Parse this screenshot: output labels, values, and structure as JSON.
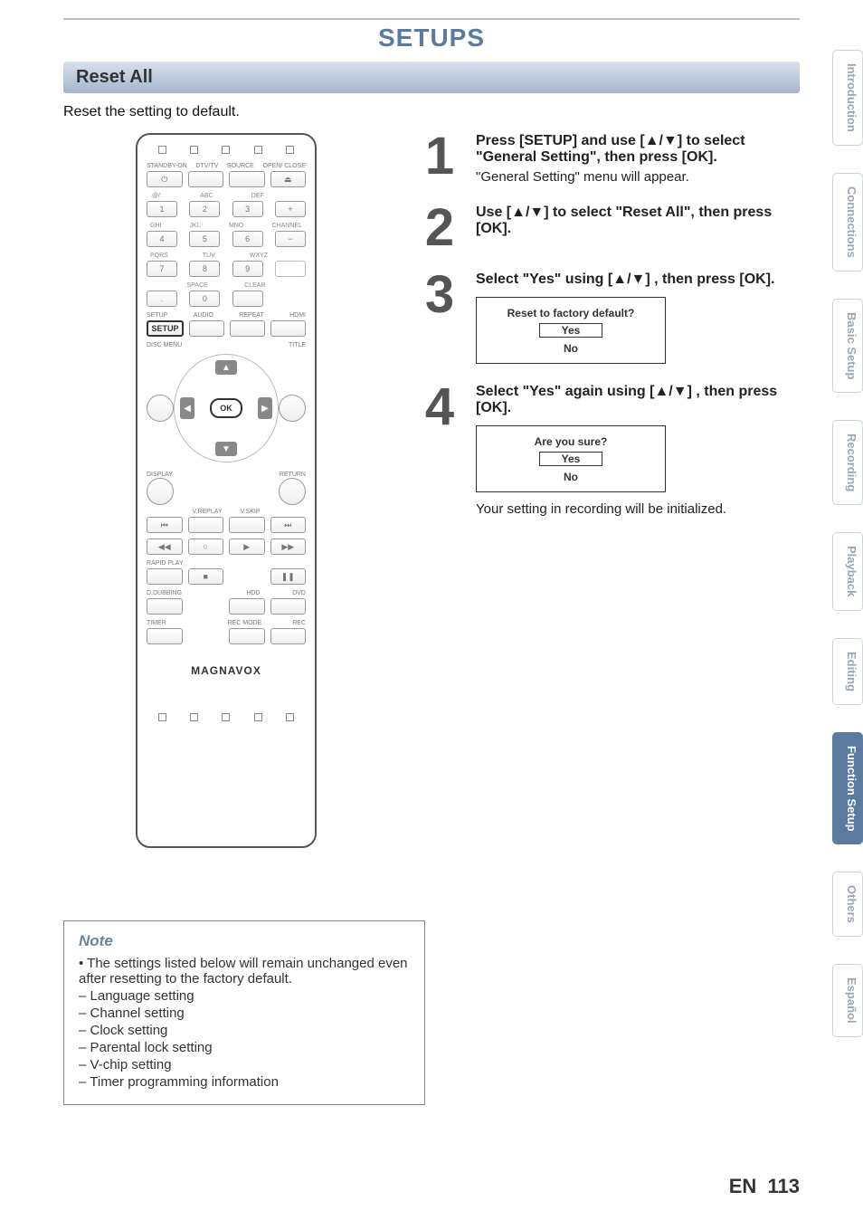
{
  "page": {
    "title": "SETUPS",
    "section": "Reset All",
    "intro": "Reset the setting to default.",
    "lang_code": "EN",
    "page_number": "113"
  },
  "remote": {
    "row1_labels": [
      "STANDBY-ON",
      "DTV/TV",
      "SOURCE",
      "OPEN/\nCLOSE"
    ],
    "row1_btns": [
      "⏻",
      "",
      "",
      "⏏"
    ],
    "keypad_labels_top": [
      ".@/:",
      "ABC",
      "DEF",
      ""
    ],
    "keypad_top_right": "+",
    "keypad_row1": [
      "1",
      "2",
      "3"
    ],
    "keypad_labels_mid": [
      "GHI",
      "JKL",
      "MNO",
      "CHANNEL"
    ],
    "keypad_row2": [
      "4",
      "5",
      "6"
    ],
    "keypad_mid_right": "−",
    "keypad_labels_bot": [
      "PQRS",
      "TUV",
      "WXYZ",
      ""
    ],
    "keypad_row3": [
      "7",
      "8",
      "9"
    ],
    "keypad_labels_last": [
      "",
      "SPACE",
      "CLEAR",
      ""
    ],
    "keypad_row4": [
      ".",
      "0",
      ""
    ],
    "func_labels": [
      "SETUP",
      "AUDIO",
      "REPEAT",
      "HDMI"
    ],
    "setup_label": "SETUP",
    "disc_menu": "DISC MENU",
    "title": "TITLE",
    "display": "DISPLAY",
    "return": "RETURN",
    "ok": "OK",
    "vreplay": "V.REPLAY",
    "vskip": "V.SKIP",
    "rapid": "RAPID PLAY",
    "ddub": "D.DUBBING",
    "hdd": "HDD",
    "dvd": "DVD",
    "timer": "TIMER",
    "recmode": "REC MODE",
    "rec": "REC",
    "brand": "MAGNAVOX"
  },
  "steps": [
    {
      "n": "1",
      "bold": "Press [SETUP] and use [▲/▼] to select \"General Setting\", then press [OK].",
      "sub": "\"General Setting\" menu will appear."
    },
    {
      "n": "2",
      "bold": "Use [▲/▼] to select \"Reset All\", then press [OK].",
      "sub": ""
    },
    {
      "n": "3",
      "bold": "Select \"Yes\" using [▲/▼] , then press [OK].",
      "sub": "",
      "dialog": {
        "title": "Reset to factory default?",
        "opts": [
          "Yes",
          "No"
        ],
        "sel": 0
      }
    },
    {
      "n": "4",
      "bold": "Select \"Yes\" again using [▲/▼] , then press [OK].",
      "sub": "Your setting in recording will be initialized.",
      "dialog": {
        "title": "Are you sure?",
        "opts": [
          "Yes",
          "No"
        ],
        "sel": 0
      }
    }
  ],
  "note": {
    "heading": "Note",
    "intro": "The settings listed below will remain unchanged even after resetting to the factory default.",
    "items": [
      "Language setting",
      "Channel setting",
      "Clock setting",
      "Parental lock setting",
      "V-chip setting",
      "Timer programming information"
    ]
  },
  "tabs": [
    {
      "label": "Introduction",
      "active": false
    },
    {
      "label": "Connections",
      "active": false
    },
    {
      "label": "Basic Setup",
      "active": false
    },
    {
      "label": "Recording",
      "active": false
    },
    {
      "label": "Playback",
      "active": false
    },
    {
      "label": "Editing",
      "active": false
    },
    {
      "label": "Function Setup",
      "active": true
    },
    {
      "label": "Others",
      "active": false
    },
    {
      "label": "Español",
      "active": false
    }
  ]
}
